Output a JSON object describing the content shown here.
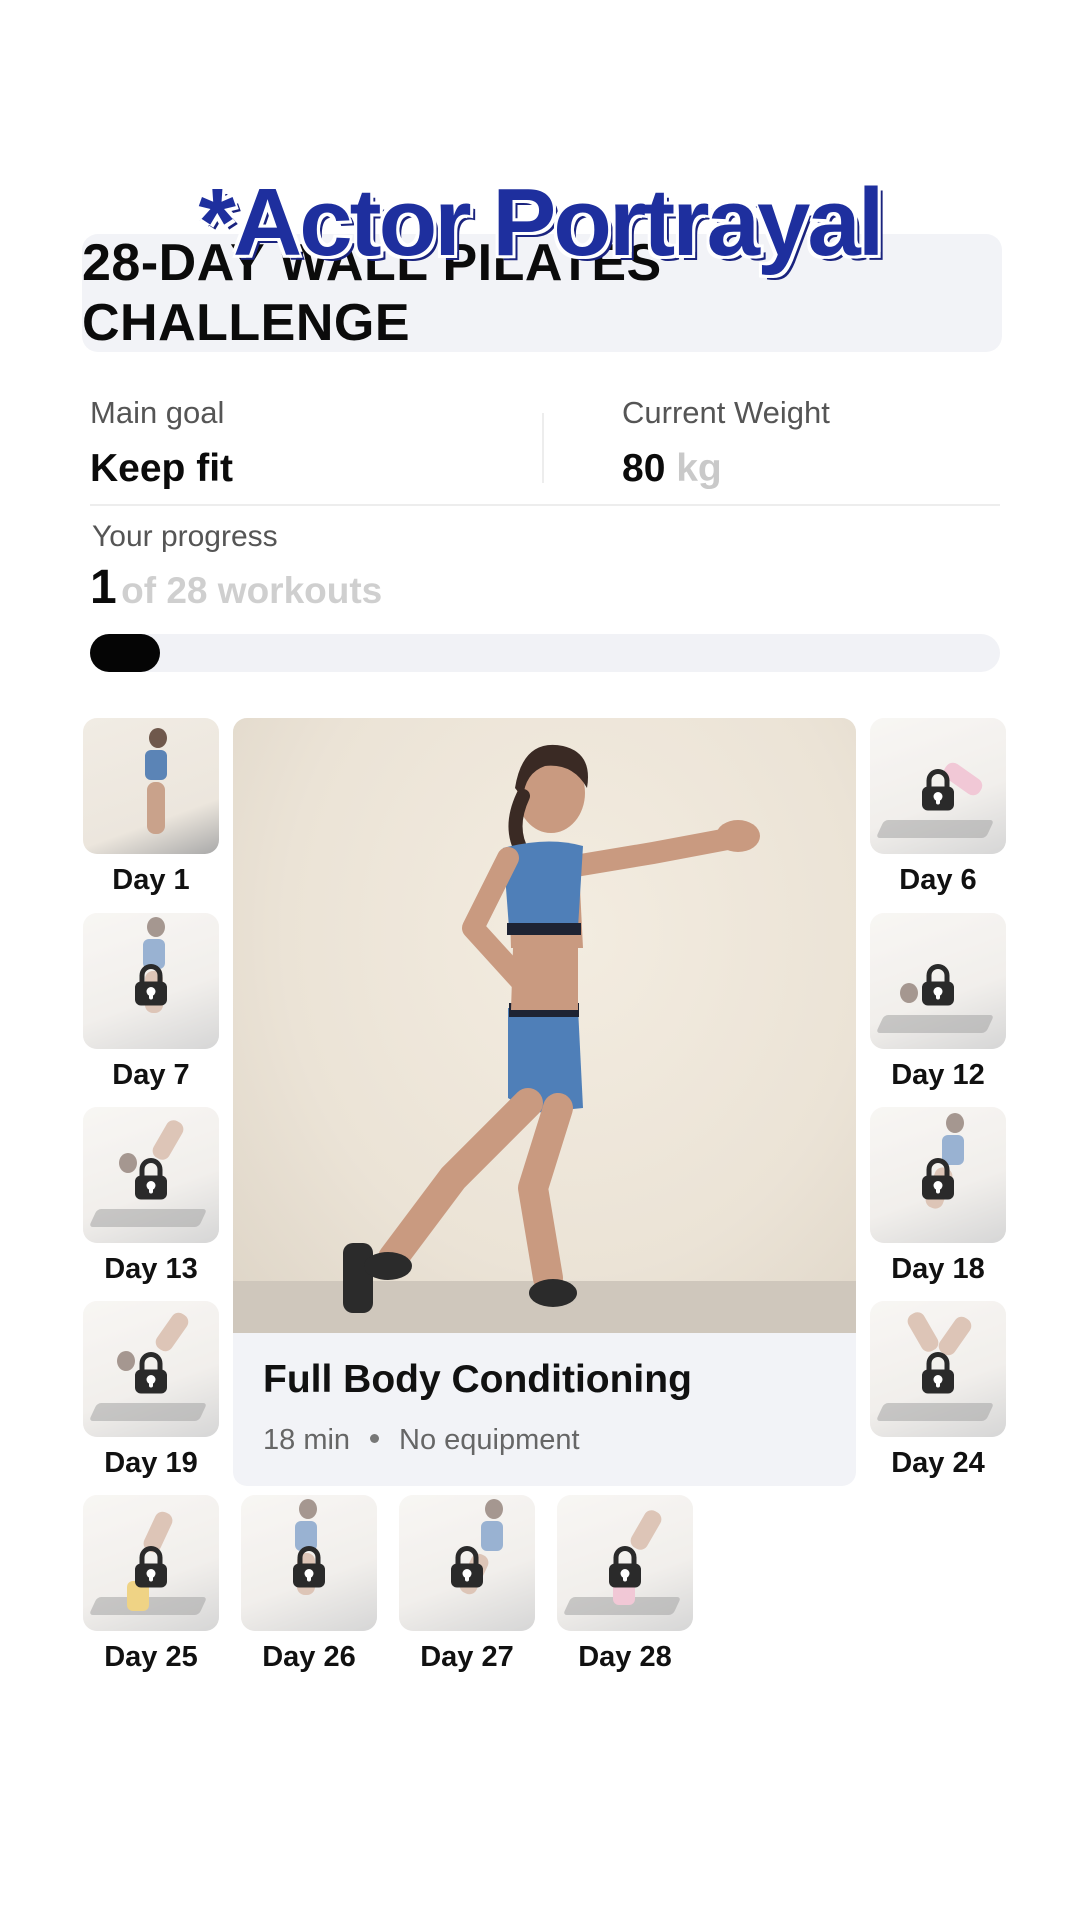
{
  "overlay_text": "*Actor Portrayal",
  "title": "28-DAY WALL PILATES CHALLENGE",
  "stats": {
    "main_goal_label": "Main goal",
    "main_goal_value": "Keep fit",
    "weight_label": "Current Weight",
    "weight_value": "80",
    "weight_unit": "kg"
  },
  "progress": {
    "label": "Your progress",
    "current": "1",
    "suffix": "of 28 workouts",
    "fraction": 0.036
  },
  "featured": {
    "title": "Full Body Conditioning",
    "duration": "18 min",
    "equipment": "No equipment"
  },
  "days": {
    "d1": "Day 1",
    "d6": "Day 6",
    "d7": "Day 7",
    "d12": "Day 12",
    "d13": "Day 13",
    "d18": "Day 18",
    "d19": "Day 19",
    "d24": "Day 24",
    "d25": "Day 25",
    "d26": "Day 26",
    "d27": "Day 27",
    "d28": "Day 28"
  },
  "icons": {
    "lock": "lock-icon"
  },
  "colors": {
    "overlay": "#1e2f9e",
    "progress_fill": "#050505",
    "track": "#f1f2f6"
  }
}
